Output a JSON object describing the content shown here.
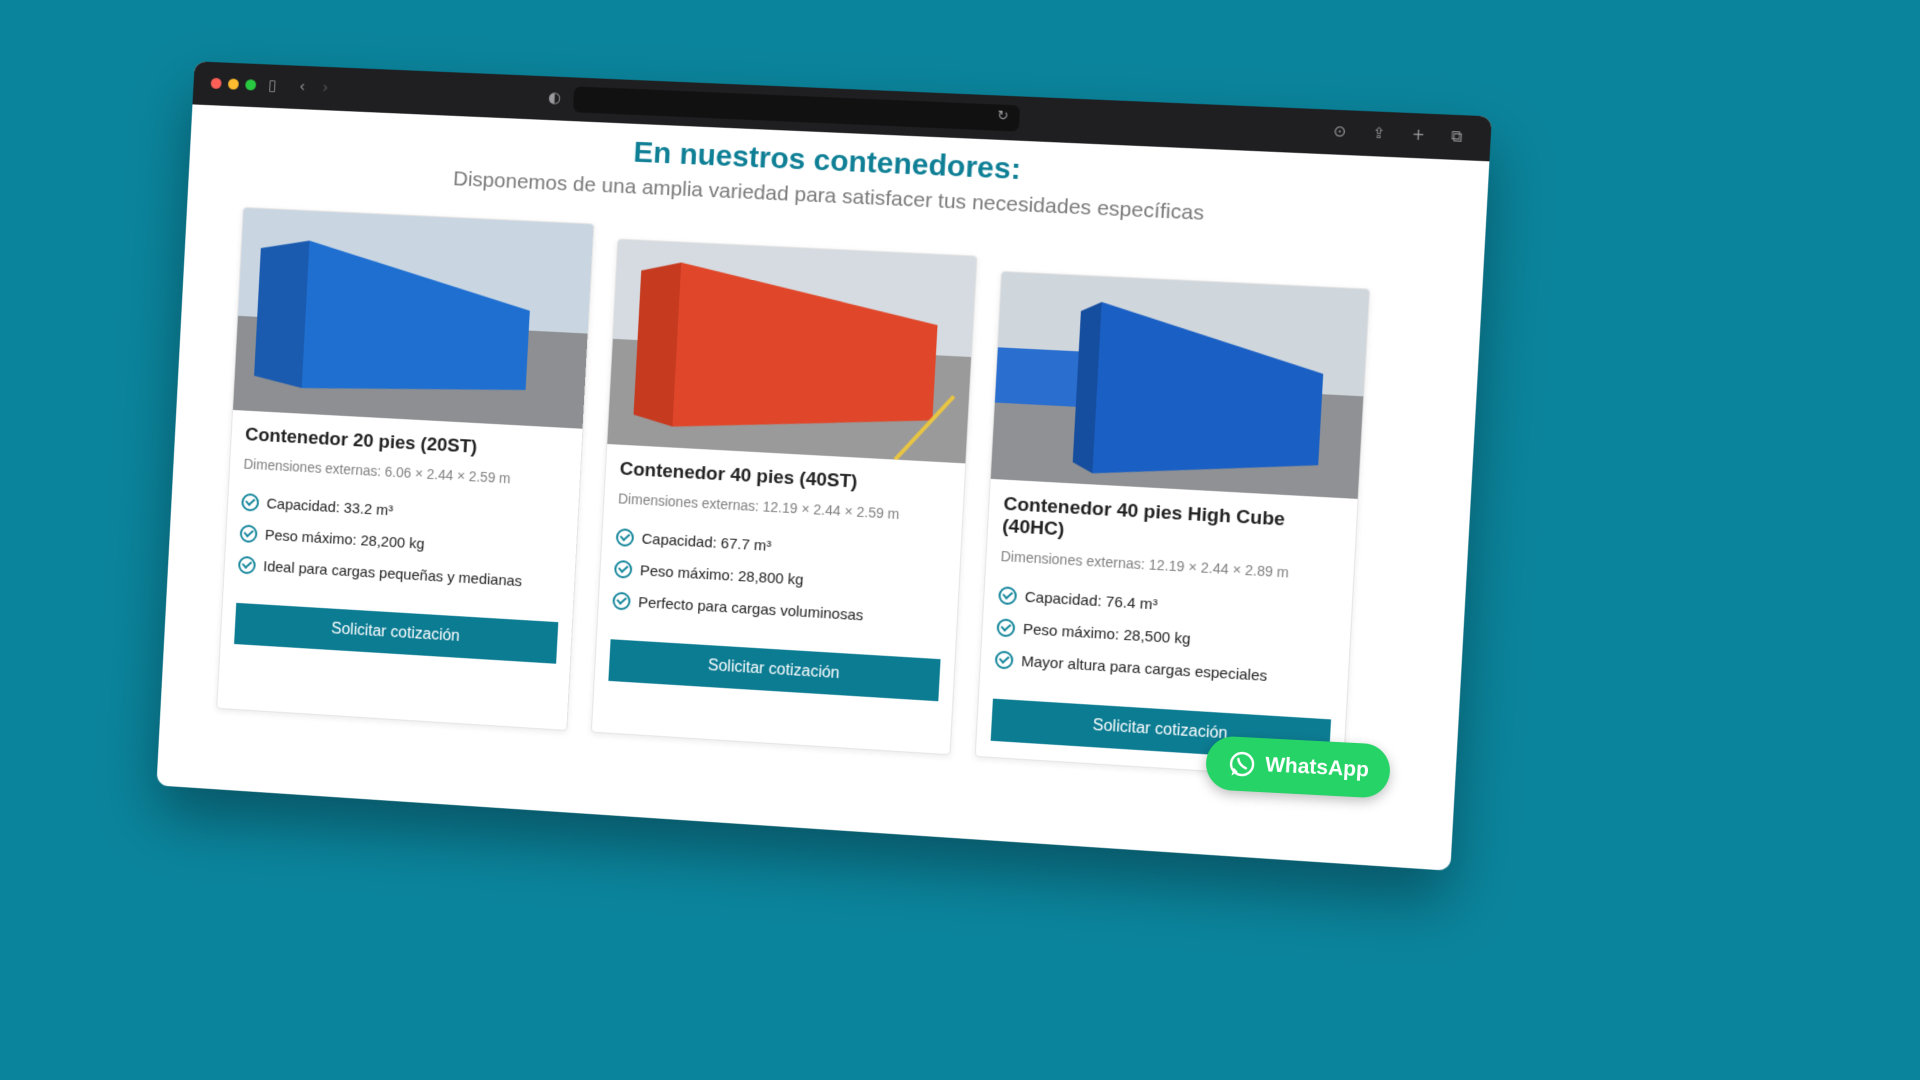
{
  "browser": {
    "controls": [
      "close",
      "minimize",
      "zoom"
    ],
    "icons": [
      "sidebar-icon",
      "back-icon",
      "forward-icon",
      "shield-icon",
      "reload-icon",
      "download-icon",
      "share-icon",
      "new-tab-icon",
      "tabs-overview-icon"
    ]
  },
  "section": {
    "title": "En nuestros contenedores:",
    "subtitle": "Disponemos de una amplia variedad para satisfacer tus necesidades específicas"
  },
  "cards": [
    {
      "title": "Contenedor 20 pies (20ST)",
      "dims": "Dimensiones externas: 6.06 × 2.44 × 2.59 m",
      "features": [
        "Capacidad: 33.2 m³",
        "Peso máximo: 28,200 kg",
        "Ideal para cargas pequeñas y medianas"
      ],
      "button": "Solicitar cotización",
      "color": "#1f6fd1"
    },
    {
      "title": "Contenedor 40 pies (40ST)",
      "dims": "Dimensiones externas: 12.19 × 2.44 × 2.59 m",
      "features": [
        "Capacidad: 67.7 m³",
        "Peso máximo: 28,800 kg",
        "Perfecto para cargas voluminosas"
      ],
      "button": "Solicitar cotización",
      "color": "#e0472a"
    },
    {
      "title": "Contenedor 40 pies High Cube (40HC)",
      "dims": "Dimensiones externas: 12.19 × 2.44 × 2.89 m",
      "features": [
        "Capacidad: 76.4 m³",
        "Peso máximo: 28,500 kg",
        "Mayor altura para cargas especiales"
      ],
      "button": "Solicitar cotización",
      "color": "#1a5fc4"
    }
  ],
  "whatsapp": {
    "label": "WhatsApp",
    "color": "#25d366"
  },
  "colors": {
    "background": "#0a849c",
    "accent": "#0e7f95",
    "button": "#0c7c93"
  }
}
